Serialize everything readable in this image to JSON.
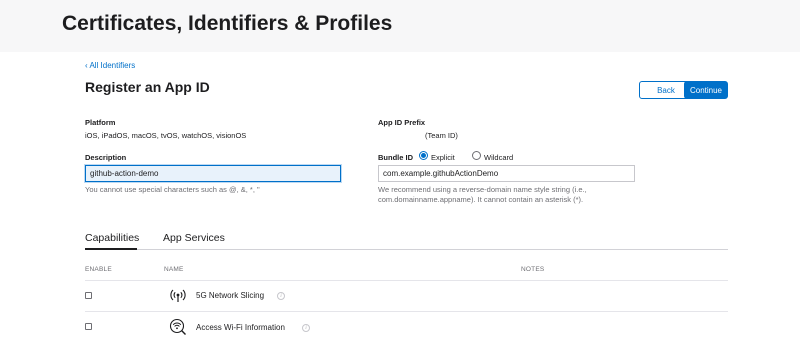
{
  "header": {
    "title": "Certificates, Identifiers & Profiles"
  },
  "nav": {
    "back_link": "‹ All Identifiers"
  },
  "form": {
    "title": "Register an App ID",
    "back_label": "Back",
    "continue_label": "Continue",
    "platform": {
      "label": "Platform",
      "value": "iOS, iPadOS, macOS, tvOS, watchOS, visionOS"
    },
    "app_id_prefix": {
      "label": "App ID Prefix",
      "value": "(Team ID)"
    },
    "description": {
      "label": "Description",
      "value": "github-action-demo",
      "hint": "You cannot use special characters such as @, &, *, \""
    },
    "bundle_id": {
      "label": "Bundle ID",
      "explicit_label": "Explicit",
      "wildcard_label": "Wildcard",
      "selected": "Explicit",
      "value": "com.example.githubActionDemo",
      "hint": "We recommend using a reverse-domain name style string (i.e., com.domainname.appname). It cannot contain an asterisk (*)."
    }
  },
  "tabs": [
    {
      "label": "Capabilities",
      "active": true
    },
    {
      "label": "App Services",
      "active": false
    }
  ],
  "capabilities_table": {
    "columns": [
      "ENABLE",
      "NAME",
      "NOTES"
    ],
    "rows": [
      {
        "name": "5G Network Slicing",
        "icon": "antenna-signal-icon",
        "enabled": false
      },
      {
        "name": "Access Wi-Fi Information",
        "icon": "wifi-info-icon",
        "enabled": false
      }
    ]
  },
  "colors": {
    "accent": "#0070c9",
    "text": "#1d1d1f",
    "muted": "#6e6e73"
  }
}
